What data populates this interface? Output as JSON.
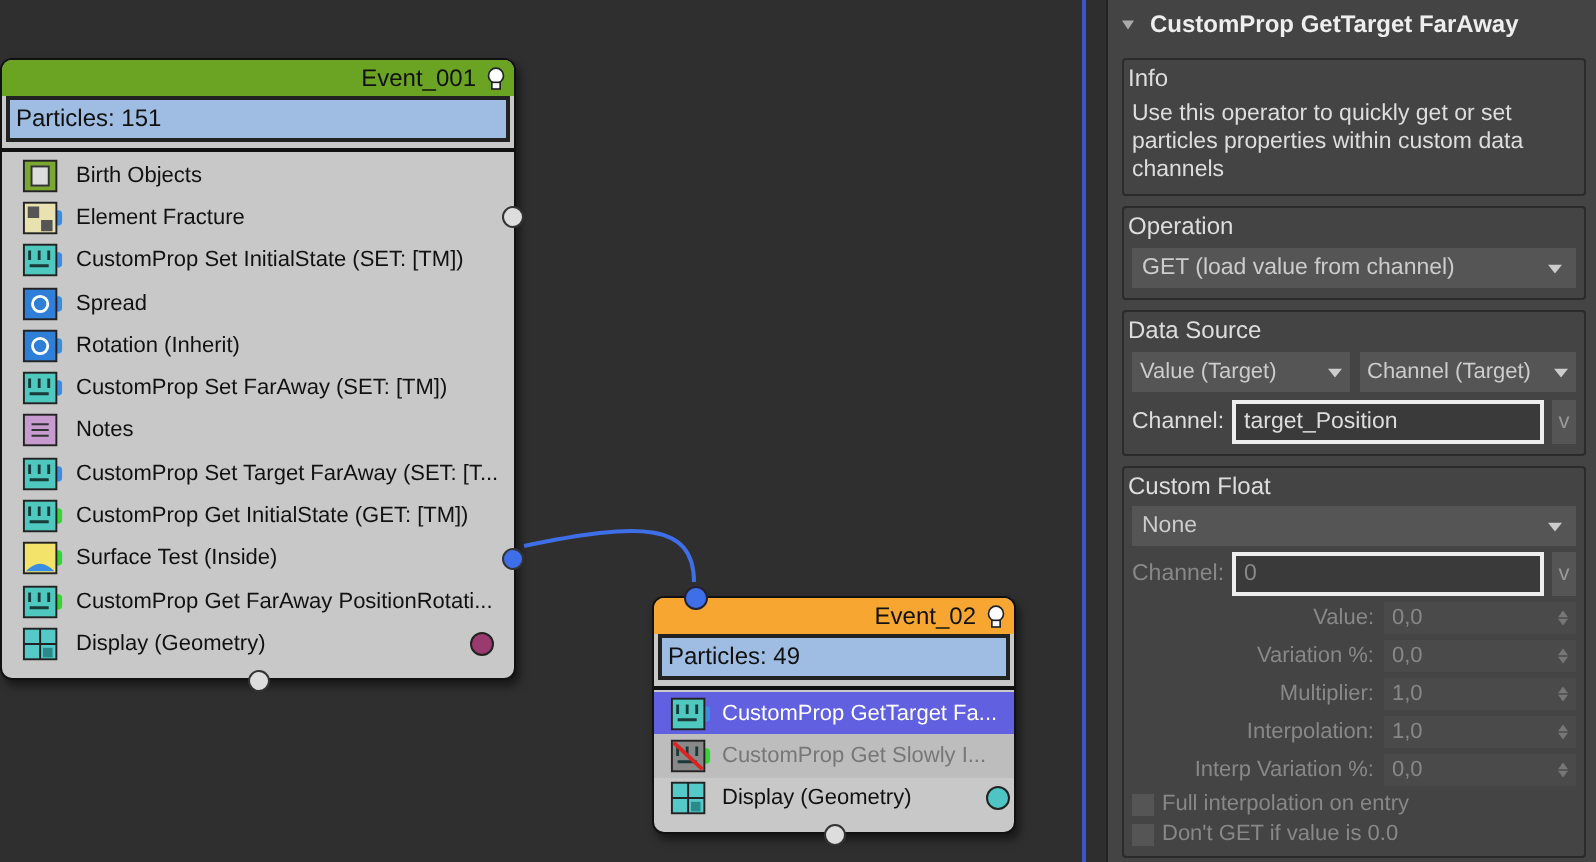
{
  "nodes": [
    {
      "title": "Event_001",
      "color": "#6ba323",
      "particles": "Particles: 151",
      "output_port": true,
      "operators": [
        {
          "label": "Birth Objects",
          "kind": "birth",
          "selected": false,
          "disabled": false
        },
        {
          "label": "Element Fracture",
          "kind": "fracture",
          "notch": {
            "color": "#3a8de0"
          },
          "selected": false,
          "disabled": false,
          "port": true,
          "connected": false
        },
        {
          "label": "CustomProp Set InitialState (SET: [TM])",
          "kind": "customprop",
          "notch": {
            "color": "#3a8de0"
          },
          "selected": false,
          "disabled": false
        },
        {
          "label": "Spread",
          "kind": "spread",
          "notch": {
            "color": "#3a8de0"
          },
          "selected": false,
          "disabled": false
        },
        {
          "label": "Rotation (Inherit)",
          "kind": "rotation",
          "notch": {
            "color": "#3a8de0"
          },
          "selected": false,
          "disabled": false
        },
        {
          "label": "CustomProp Set FarAway (SET: [TM])",
          "kind": "customprop",
          "notch": {
            "color": "#3a8de0"
          },
          "selected": false,
          "disabled": false
        },
        {
          "label": "Notes",
          "kind": "notes",
          "selected": false,
          "disabled": false
        },
        {
          "label": "CustomProp Set Target FarAway (SET: [T...",
          "kind": "customprop",
          "notch": {
            "color": "#3a8de0"
          },
          "selected": false,
          "disabled": false
        },
        {
          "label": "CustomProp Get InitialState (GET: [TM])",
          "kind": "customprop",
          "notch": {
            "color": "#33d633"
          },
          "selected": false,
          "disabled": false
        },
        {
          "label": "Surface Test (Inside)",
          "kind": "surface",
          "notch": {
            "color": "#33d633"
          },
          "selected": false,
          "disabled": false,
          "port": true,
          "connected": true
        },
        {
          "label": "CustomProp Get FarAway PositionRotati...",
          "kind": "customprop",
          "notch": {
            "color": "#33d633"
          },
          "selected": false,
          "disabled": false
        },
        {
          "label": "Display (Geometry)",
          "kind": "display",
          "selected": false,
          "disabled": false,
          "color": "#9b3a6e"
        }
      ]
    },
    {
      "title": "Event_02",
      "color": "#f7a731",
      "particles": "Particles: 49",
      "output_port": true,
      "input_port": true,
      "operators": [
        {
          "label": "CustomProp GetTarget Fa...",
          "kind": "customprop",
          "notch": {
            "color": "#3a8de0"
          },
          "selected": true,
          "disabled": false
        },
        {
          "label": "CustomProp Get Slowly I...",
          "kind": "customprop",
          "notch": {
            "color": "#33d633"
          },
          "selected": false,
          "disabled": true
        },
        {
          "label": "Display (Geometry)",
          "kind": "display",
          "selected": false,
          "disabled": false,
          "color": "#4fc4c4"
        }
      ]
    }
  ],
  "panel": {
    "title": "CustomProp GetTarget FarAway",
    "expanded": true,
    "info": {
      "title": "Info",
      "text": "Use this operator to quickly get or set particles properties within custom data channels"
    },
    "operation": {
      "title": "Operation",
      "value": "GET (load value from channel)"
    },
    "data_source": {
      "title": "Data Source",
      "dropdowns": [
        "Value (Target)",
        "Channel (Target)"
      ],
      "channel_label": "Channel:",
      "channel_value": "target_Position",
      "channel_button": "v"
    },
    "custom_float": {
      "title": "Custom Float",
      "dropdown": "None",
      "channel_label": "Channel:",
      "channel_value": "0",
      "channel_button": "v",
      "disabled": true,
      "spinners": [
        {
          "label": "Value:",
          "value": "0,0"
        },
        {
          "label": "Variation %:",
          "value": "0,0"
        },
        {
          "label": "Multiplier:",
          "value": "1,0"
        },
        {
          "label": "Interpolation:",
          "value": "1,0"
        },
        {
          "label": "Interp Variation %:",
          "value": "0,0"
        }
      ],
      "checkboxes": [
        {
          "label": "Full interpolation on entry",
          "checked": false
        },
        {
          "label": "Don't GET if value is 0.0",
          "checked": false
        }
      ]
    }
  }
}
